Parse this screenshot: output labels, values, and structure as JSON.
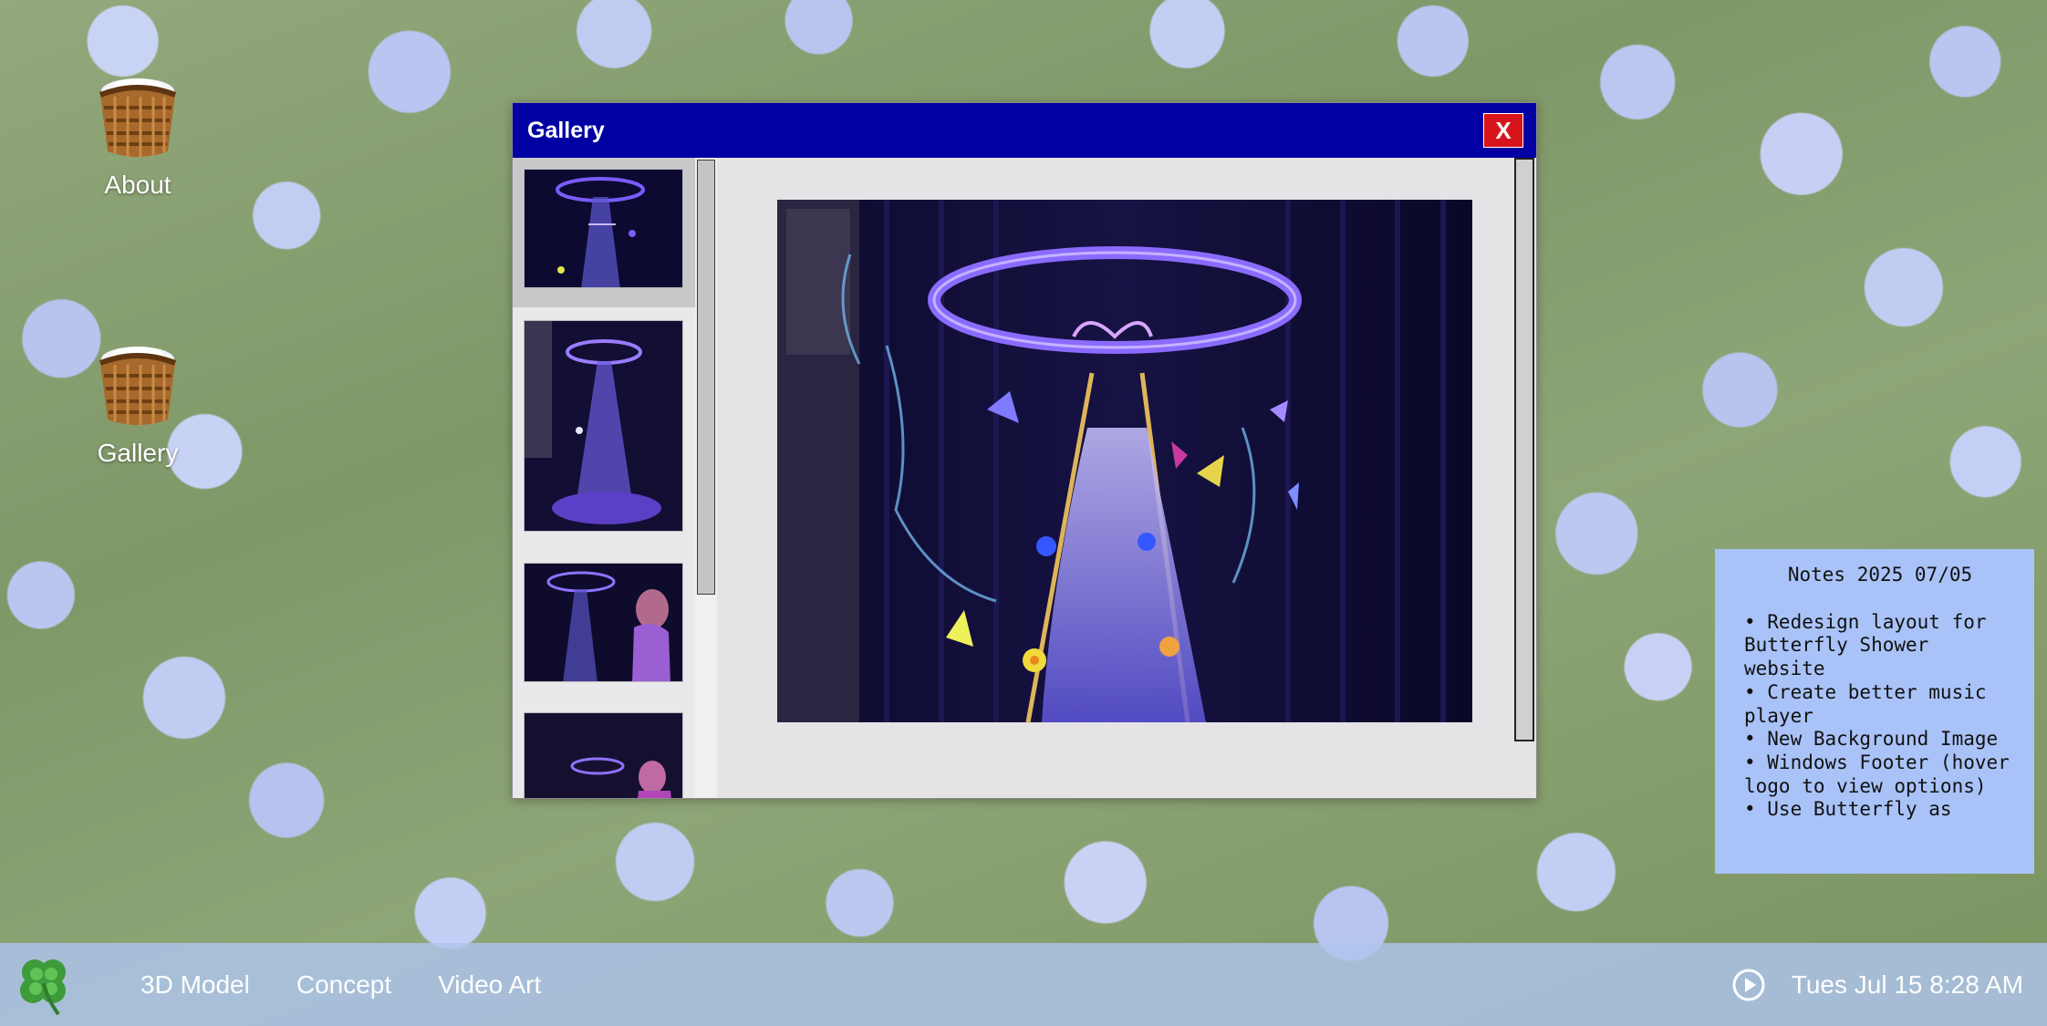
{
  "desktop": {
    "icons": [
      {
        "label": "About"
      },
      {
        "label": "Gallery"
      }
    ]
  },
  "gallery_window": {
    "title": "Gallery",
    "close_label": "X",
    "thumbnails": [
      {
        "alt": "installation thumbnail 1"
      },
      {
        "alt": "installation thumbnail 2"
      },
      {
        "alt": "installation thumbnail 3"
      },
      {
        "alt": "installation thumbnail 4"
      }
    ]
  },
  "notes": {
    "heading": "Notes 2025 07/05",
    "items": [
      "• Redesign layout for Butterfly Shower website",
      "• Create better music player",
      "• New Background Image",
      "• Windows Footer (hover logo to view options)",
      "• Use Butterfly as"
    ]
  },
  "taskbar": {
    "nav": [
      "3D Model",
      "Concept",
      "Video Art"
    ],
    "clock": "Tues Jul 15 8:28 AM"
  },
  "colors": {
    "titlebar": "#0000a3",
    "close": "#d8141b",
    "notes_bg": "#a9c3f8",
    "taskbar": "#afc4ee"
  }
}
